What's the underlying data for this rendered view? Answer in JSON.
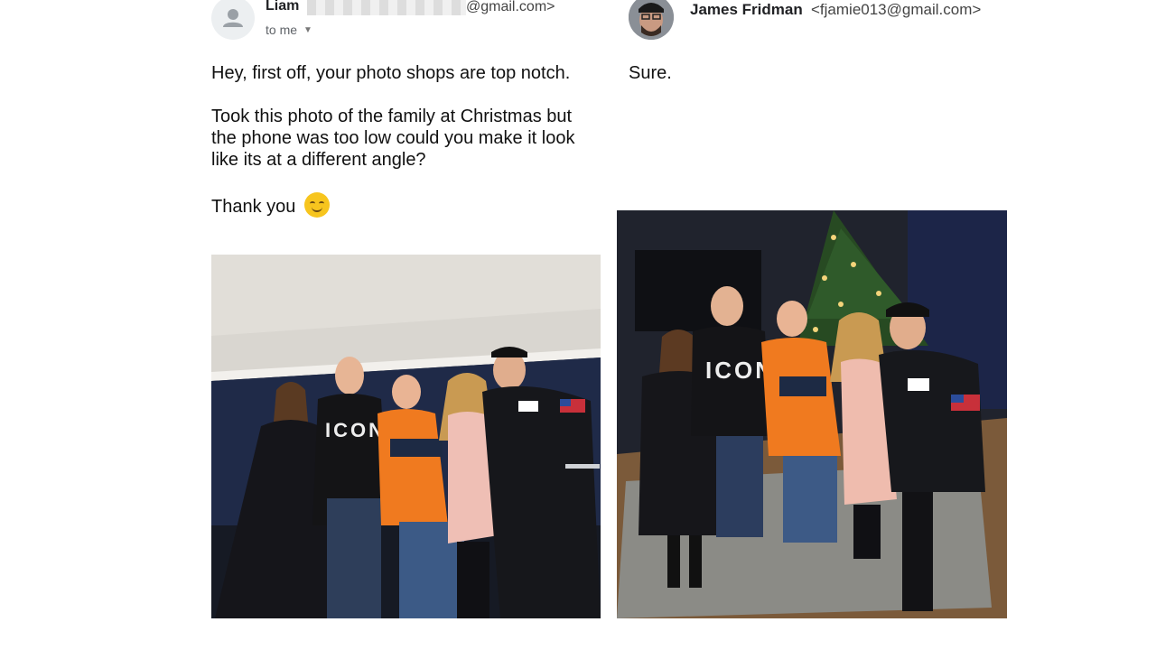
{
  "original_message": {
    "sender_name": "Liam",
    "sender_email_suffix": "@gmail.com>",
    "recipient": "to me",
    "body": [
      "Hey, first off, your photo shops are top notch.",
      "Took this photo of the family at Christmas but the phone was too low could you make it look like its at a different angle?",
      "Thank you"
    ],
    "emoji": "smiling-face-emoji"
  },
  "reply_message": {
    "sender_name": "James Fridman",
    "sender_email": "<fjamie013@gmail.com>",
    "body": "Sure."
  },
  "colors": {
    "background": "#ffffff",
    "text": "#111111",
    "muted": "#5f6368"
  }
}
